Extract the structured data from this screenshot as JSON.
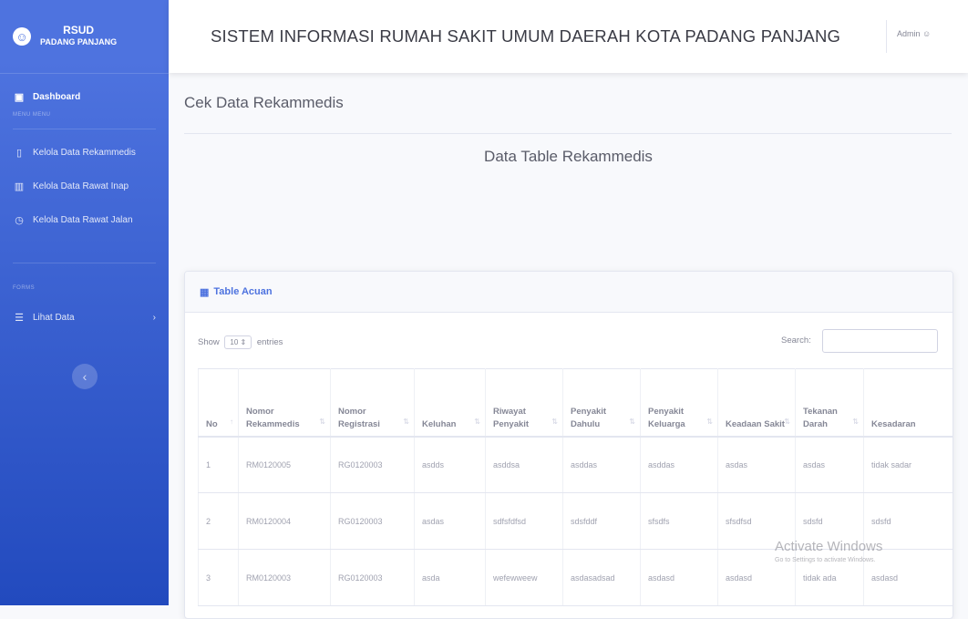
{
  "sidebar": {
    "brand_line1": "RSUD",
    "brand_line2": "PADANG PANJANG",
    "brand_icon": "smile-icon",
    "dashboard_label": "Dashboard",
    "heading1": "MENU MENU",
    "items": [
      {
        "label": "Kelola Data Rekammedis",
        "icon": "folder-icon"
      },
      {
        "label": "Kelola Data Rawat Inap",
        "icon": "chart-icon"
      },
      {
        "label": "Kelola Data Rawat Jalan",
        "icon": "clock-icon"
      }
    ],
    "heading2": "FORMS",
    "lihat_data_label": "Lihat Data",
    "colors": {
      "from": "#4e73df",
      "to": "#224abe"
    }
  },
  "topbar": {
    "title": "SISTEM INFORMASI RUMAH SAKIT UMUM DAERAH KOTA PADANG PANJANG",
    "user_label": "Admin"
  },
  "page": {
    "title": "Cek Data Rekammedis",
    "section_title": "Data Table Rekammedis"
  },
  "card": {
    "header": "Table Acuan",
    "show_label": "Show",
    "entries_value": "10",
    "entries_label": "entries",
    "search_label": "Search:",
    "search_value": ""
  },
  "table": {
    "columns": [
      "No",
      "Nomor Rekammedis",
      "Nomor Registrasi",
      "Keluhan",
      "Riwayat Penyakit",
      "Penyakit Dahulu",
      "Penyakit Keluarga",
      "Keadaan Sakit",
      "Tekanan Darah",
      "Kesadaran"
    ],
    "rows": [
      [
        "1",
        "RM0120005",
        "RG0120003",
        "asdds",
        "asddsa",
        "asddas",
        "asddas",
        "asdas",
        "asdas",
        "tidak sadar"
      ],
      [
        "2",
        "RM0120004",
        "RG0120003",
        "asdas",
        "sdfsfdfsd",
        "sdsfddf",
        "sfsdfs",
        "sfsdfsd",
        "sdsfd",
        "sdsfd"
      ],
      [
        "3",
        "RM0120003",
        "RG0120003",
        "asda",
        "wefewweew",
        "asdasadsad",
        "asdasd",
        "asdasd",
        "tidak ada",
        "asdasd"
      ]
    ]
  },
  "watermark": {
    "line1": "Activate Windows",
    "line2": "Go to Settings to activate Windows."
  }
}
